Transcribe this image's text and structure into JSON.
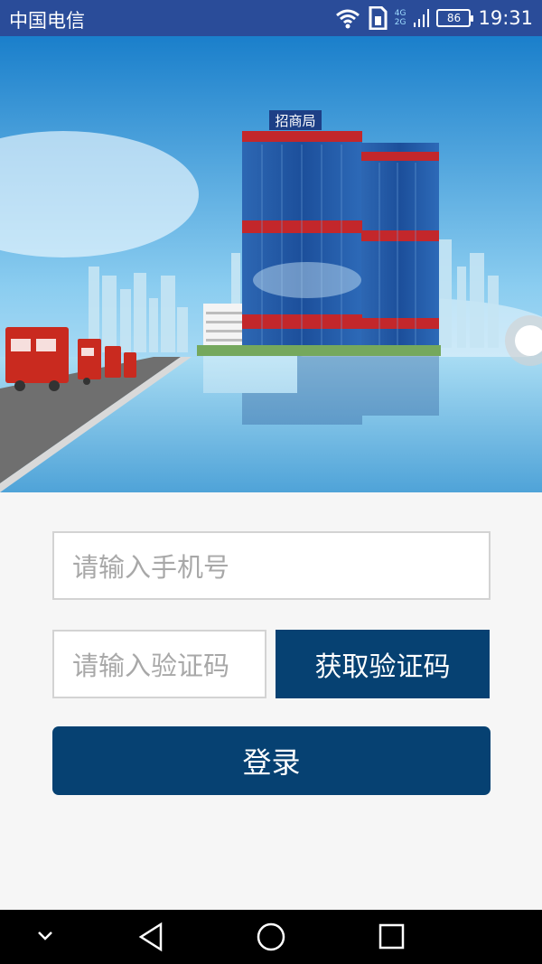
{
  "status_bar": {
    "carrier": "中国电信",
    "network_top": "4G",
    "network_bottom": "2G",
    "battery": "86",
    "time": "19:31",
    "icons": [
      "wifi-icon",
      "sim-card-icon",
      "signal-icon",
      "battery-icon"
    ]
  },
  "banner": {
    "building_sign": "招商局"
  },
  "login_form": {
    "phone_placeholder": "请输入手机号",
    "code_placeholder": "请输入验证码",
    "get_code_label": "获取验证码",
    "login_label": "登录"
  },
  "navigation_bar": {
    "icons": [
      "chevron-down-icon",
      "back-triangle-icon",
      "home-circle-icon",
      "recent-square-icon"
    ]
  },
  "colors": {
    "status_bar": "#2a4c99",
    "button": "#064172",
    "form_background": "#f6f6f6"
  }
}
